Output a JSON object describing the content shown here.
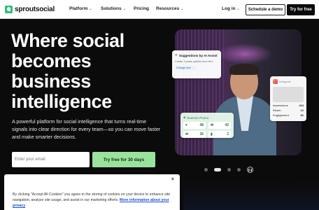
{
  "nav": {
    "logo_text": "sproutsocial",
    "items": [
      {
        "label": "Platform",
        "has_menu": true
      },
      {
        "label": "Solutions",
        "has_menu": true
      },
      {
        "label": "Pricing",
        "has_menu": false
      },
      {
        "label": "Resources",
        "has_menu": true
      }
    ],
    "login": "Log in",
    "demo_button": "Schedule a demo",
    "free_button": "Try for free"
  },
  "hero": {
    "headline": "Where social becomes business intelligence",
    "subcopy": "A powerful platform for social intelligence that turns real-time signals into clear direction for every team—so you can move faster and make smarter decisions.",
    "email_placeholder": "Enter your email",
    "cta": "Try free for 30 days"
  },
  "cards": {
    "ai": {
      "title": "Suggestions by AI Assist",
      "prompt": "Create 3 posts options from text",
      "chip": "Change tone"
    },
    "stats": {
      "source": "Instagram",
      "rows": [
        {
          "label": "Impressions",
          "value": "424"
        },
        {
          "label": "Reach",
          "value": "12"
        },
        {
          "label": "Engagement",
          "value": "81"
        }
      ]
    },
    "promo": {
      "title": "Summer Promo",
      "metrics": [
        "48",
        "42",
        "36",
        "2"
      ]
    }
  },
  "carousel": {
    "total_slides": 5,
    "active_index": 1
  },
  "cookie": {
    "text": "By clicking \"Accept All Cookies\" you agree to the storing of cookies on your device to enhance site navigation, analyze site usage, and assist in our marketing efforts.",
    "link": "More information about your privacy",
    "close": "×"
  },
  "colors": {
    "accent_green": "#9ae39c",
    "brand_green": "#2fbf71",
    "background": "#0b0b0b"
  }
}
